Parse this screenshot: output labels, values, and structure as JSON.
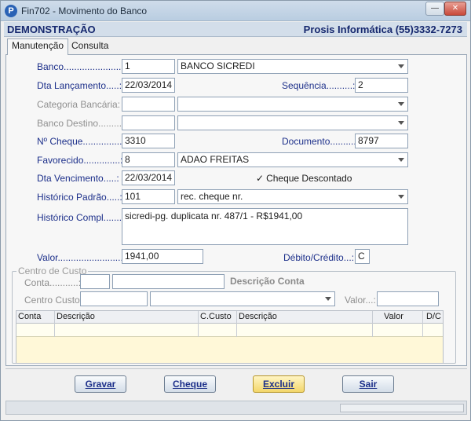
{
  "window": {
    "title": "Fin702 - Movimento do Banco",
    "app_icon_letter": "P",
    "minimize_glyph": "—",
    "close_glyph": "✕"
  },
  "header": {
    "left": "DEMONSTRAÇÃO",
    "right": "Prosis Informática (55)3332-7273"
  },
  "tabs": [
    {
      "label": "Manutenção",
      "active": true
    },
    {
      "label": "Consulta",
      "active": false
    }
  ],
  "form": {
    "banco": {
      "label": "Banco..........................:",
      "code": "1",
      "name": "BANCO SICREDI"
    },
    "dta_lancamento": {
      "label": "Dta Lançamento.....:",
      "value": "22/03/2014"
    },
    "sequencia": {
      "label": "Sequência..........:",
      "value": "2"
    },
    "categoria": {
      "label": "Categoria Bancária:",
      "code": "",
      "name": ""
    },
    "banco_destino": {
      "label": "Banco Destino.........:",
      "code": "",
      "name": ""
    },
    "cheque": {
      "label": "Nº Cheque...............:",
      "value": "3310"
    },
    "documento": {
      "label": "Documento..........:",
      "value": "8797"
    },
    "favorecido": {
      "label": "Favorecido..............:",
      "code": "8",
      "name": "ADAO FREITAS"
    },
    "dta_vencimento": {
      "label": "Dta Vencimento.....:",
      "value": "22/03/2014"
    },
    "cheque_descontado": {
      "label": "Cheque Descontado",
      "checked": true,
      "mark": "✓"
    },
    "historico_padrao": {
      "label": "Histórico Padrão.....:",
      "code": "101",
      "name": "rec. cheque nr."
    },
    "historico_compl": {
      "label": "Histórico Compl.......:",
      "value": "sicredi-pg. duplicata nr. 487/1 - R$1941,00"
    },
    "valor": {
      "label": "Valor............................:",
      "value": "1941,00"
    },
    "debito_credito": {
      "label": "Débito/Crédito...:",
      "value": "C"
    }
  },
  "centro_custo": {
    "group_title": "Centro de Custo",
    "conta_label": "Conta...........:",
    "descricao_conta": "Descrição Conta",
    "centro_label": "Centro Custo:",
    "valor_label": "Valor...:"
  },
  "grid": {
    "columns": [
      "Conta",
      "Descrição",
      "C.Custo",
      "Descrição",
      "Valor",
      "D/C"
    ]
  },
  "buttons": {
    "gravar": "Gravar",
    "cheque": "Cheque",
    "excluir": "Excluir",
    "sair": "Sair"
  }
}
